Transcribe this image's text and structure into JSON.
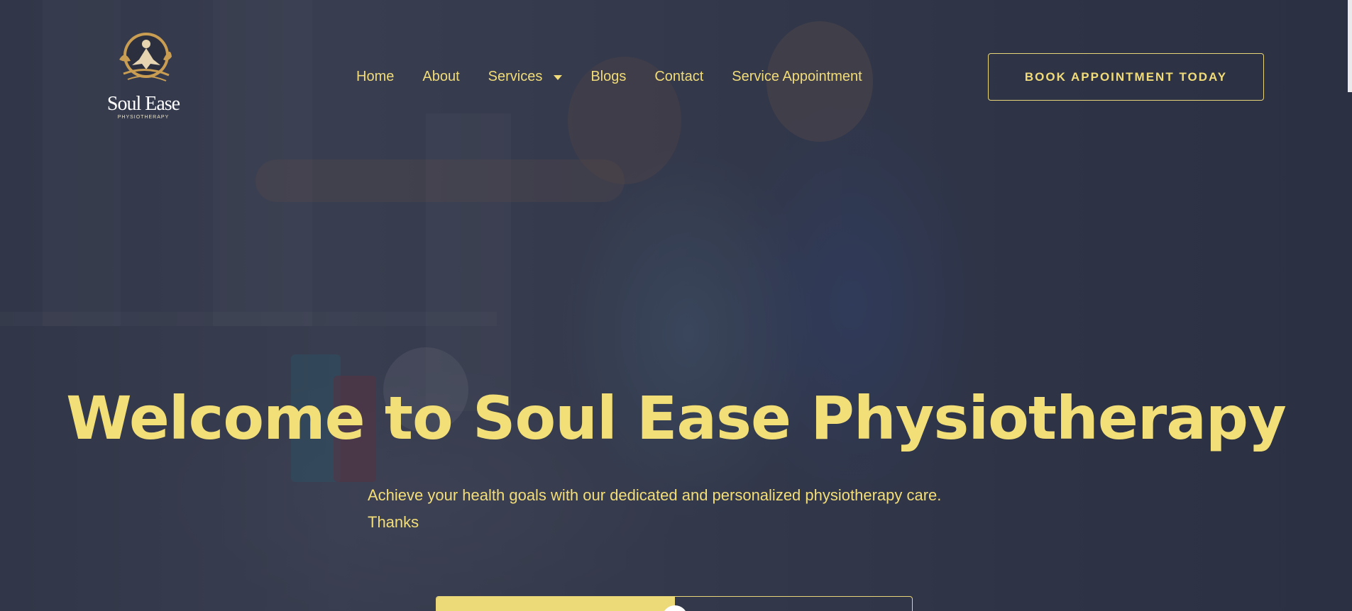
{
  "logo": {
    "brand": "Soul Ease",
    "tagline": "PHYSIOTHERAPY"
  },
  "nav": {
    "items": [
      {
        "label": "Home"
      },
      {
        "label": "About"
      },
      {
        "label": "Services",
        "icon": "caret-down-icon"
      },
      {
        "label": "Blogs"
      },
      {
        "label": "Contact"
      },
      {
        "label": "Service Appointment"
      }
    ]
  },
  "header": {
    "cta_label": "BOOK APPOINTMENT TODAY"
  },
  "hero": {
    "title": "Welcome to Soul Ease Physiotherapy",
    "subtitle_line1": "Achieve your health goals with our dedicated and personalized physiotherapy care.",
    "subtitle_line2": "Thanks"
  },
  "colors": {
    "accent": "#f2df78",
    "overlay": "#1e2234"
  }
}
